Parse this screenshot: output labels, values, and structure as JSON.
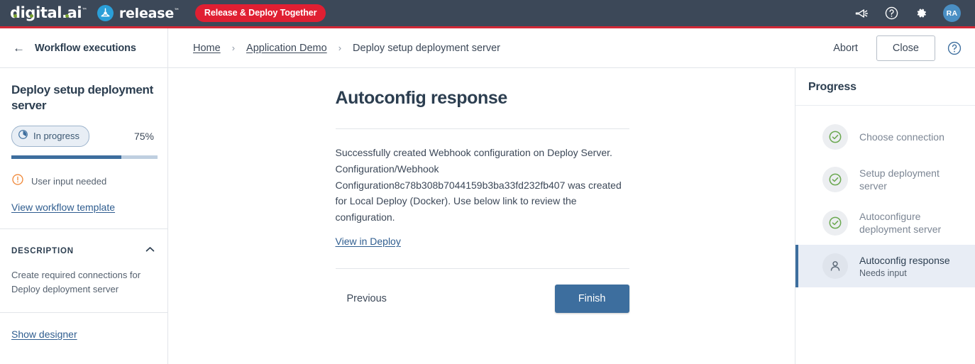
{
  "topbar": {
    "logo_text": "digital.ai",
    "logo_tm": "™",
    "release_word": "release",
    "release_tm": "™",
    "tagline": "Release & Deploy Together",
    "brand_red": "#e01f32",
    "bar_color": "#3c4858",
    "accent_line": "#d32836",
    "logo_dot_color": "#78a22f",
    "release_icon_color": "#2a9fd8",
    "icons": [
      "announcement-icon",
      "help-icon",
      "settings-icon"
    ],
    "avatar_initials": "RA",
    "avatar_color": "#4a8fc4"
  },
  "subbar": {
    "back_label": "Workflow executions",
    "breadcrumb": [
      {
        "label": "Home",
        "link": true
      },
      {
        "label": "Application Demo",
        "link": true
      },
      {
        "label": "Deploy setup deployment server",
        "link": false
      }
    ],
    "separator": "›",
    "abort_label": "Abort",
    "close_label": "Close"
  },
  "sidebar": {
    "title": "Deploy setup deployment server",
    "status_label": "In progress",
    "percent": "75%",
    "progress_value": 75,
    "progress_fill_color": "#3d6e9e",
    "progress_track_color": "#bfcfe0",
    "input_needed": "User input needed",
    "input_needed_color": "#f08a3c",
    "view_template_link": "View workflow template",
    "description_heading": "DESCRIPTION",
    "description_text": "Create required connections for Deploy deployment server",
    "show_designer_link": "Show designer"
  },
  "main": {
    "title": "Autoconfig response",
    "body": "Successfully created Webhook configuration on Deploy Server. Configuration/Webhook Configuration8c78b308b7044159b3ba33fd232fb407 was created for Local Deploy (Docker). Use below link to review the configuration.",
    "view_link": "View in Deploy",
    "previous_label": "Previous",
    "finish_label": "Finish",
    "finish_color": "#3d6e9e"
  },
  "progress_panel": {
    "title": "Progress",
    "active_bg": "#e8edf5",
    "active_border": "#3d6e9e",
    "check_color": "#6aa84f",
    "items": [
      {
        "label": "Choose connection",
        "sub": "",
        "state": "done",
        "icon": "check-circle-icon"
      },
      {
        "label": "Setup deployment server",
        "sub": "",
        "state": "done",
        "icon": "check-circle-icon"
      },
      {
        "label": "Autoconfigure deployment server",
        "sub": "",
        "state": "done",
        "icon": "check-circle-icon"
      },
      {
        "label": "Autoconfig response",
        "sub": "Needs input",
        "state": "active",
        "icon": "user-icon"
      }
    ]
  }
}
